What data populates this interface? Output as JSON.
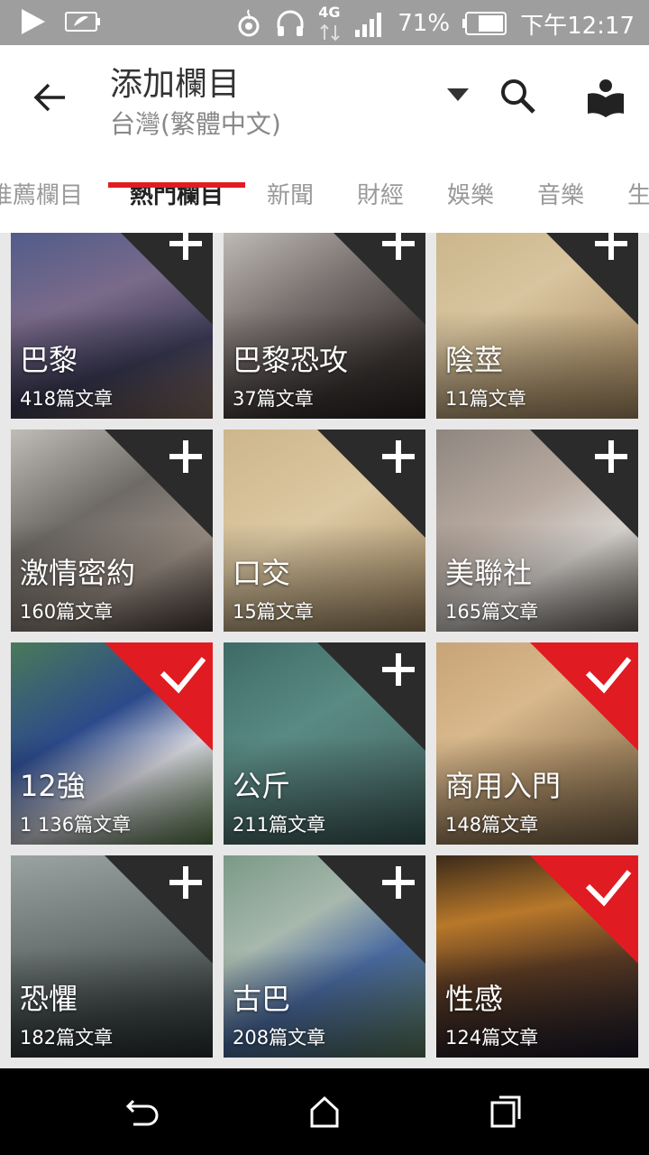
{
  "status": {
    "percent": "71%",
    "time": "下午12:17",
    "network": "4G"
  },
  "header": {
    "title": "添加欄目",
    "subtitle": "台灣(繁體中文)"
  },
  "tabs": [
    "推薦欄目",
    "熱門欄目",
    "新聞",
    "財經",
    "娛樂",
    "音樂",
    "生"
  ],
  "colors": {
    "accent": "#e11b22",
    "plus_corner": "#2b2b2b"
  },
  "tiles": [
    {
      "name": "巴黎",
      "count": "418篇文章",
      "selected": false
    },
    {
      "name": "巴黎恐攻",
      "count": "37篇文章",
      "selected": false
    },
    {
      "name": "陰莖",
      "count": "11篇文章",
      "selected": false
    },
    {
      "name": "激情密約",
      "count": "160篇文章",
      "selected": false
    },
    {
      "name": "口交",
      "count": "15篇文章",
      "selected": false
    },
    {
      "name": "美聯社",
      "count": "165篇文章",
      "selected": false
    },
    {
      "name": "12強",
      "count": "1 136篇文章",
      "selected": true
    },
    {
      "name": "公斤",
      "count": "211篇文章",
      "selected": false
    },
    {
      "name": "商用入門",
      "count": "148篇文章",
      "selected": true
    },
    {
      "name": "恐懼",
      "count": "182篇文章",
      "selected": false
    },
    {
      "name": "古巴",
      "count": "208篇文章",
      "selected": false
    },
    {
      "name": "性感",
      "count": "124篇文章",
      "selected": true
    }
  ]
}
